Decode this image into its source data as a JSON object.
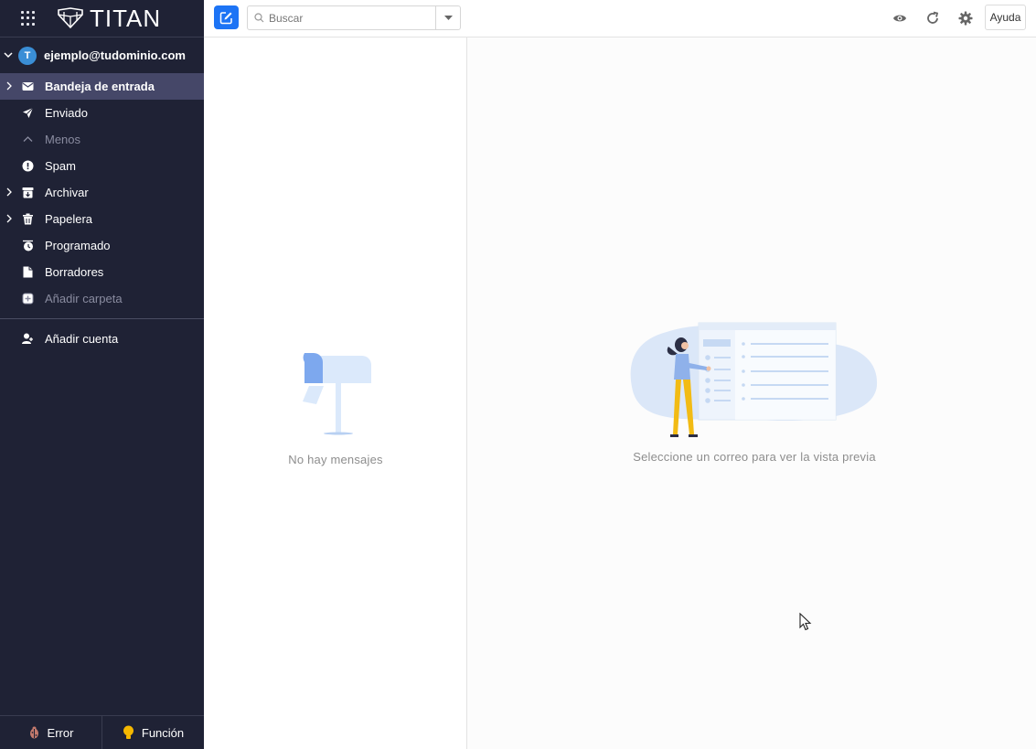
{
  "app": {
    "name": "TITAN"
  },
  "account": {
    "initial": "T",
    "email": "ejemplo@tudominio.com"
  },
  "folders": [
    {
      "label": "Bandeja de entrada",
      "icon": "inbox-icon",
      "expandable": true,
      "active": true
    },
    {
      "label": "Enviado",
      "icon": "send-icon",
      "expandable": false
    },
    {
      "label": "Menos",
      "icon": "chevron-up-icon",
      "expandable": false,
      "muted": true
    },
    {
      "label": "Spam",
      "icon": "alert-icon",
      "expandable": false
    },
    {
      "label": "Archivar",
      "icon": "archive-icon",
      "expandable": true
    },
    {
      "label": "Papelera",
      "icon": "trash-icon",
      "expandable": true
    },
    {
      "label": "Programado",
      "icon": "clock-icon",
      "expandable": false
    },
    {
      "label": "Borradores",
      "icon": "draft-icon",
      "expandable": false
    },
    {
      "label": "Añadir carpeta",
      "icon": "add-folder-icon",
      "expandable": false,
      "muted": true
    }
  ],
  "add_account": {
    "label": "Añadir cuenta"
  },
  "bottom": {
    "error_label": "Error",
    "feature_label": "Función"
  },
  "toolbar": {
    "search_placeholder": "Buscar",
    "help_label": "Ayuda"
  },
  "list": {
    "empty_text": "No hay mensajes"
  },
  "preview": {
    "empty_text": "Seleccione un correo para ver la vista previa"
  },
  "colors": {
    "sidebar": "#1f2235",
    "active_item": "#454768",
    "accent": "#1d74f5"
  }
}
